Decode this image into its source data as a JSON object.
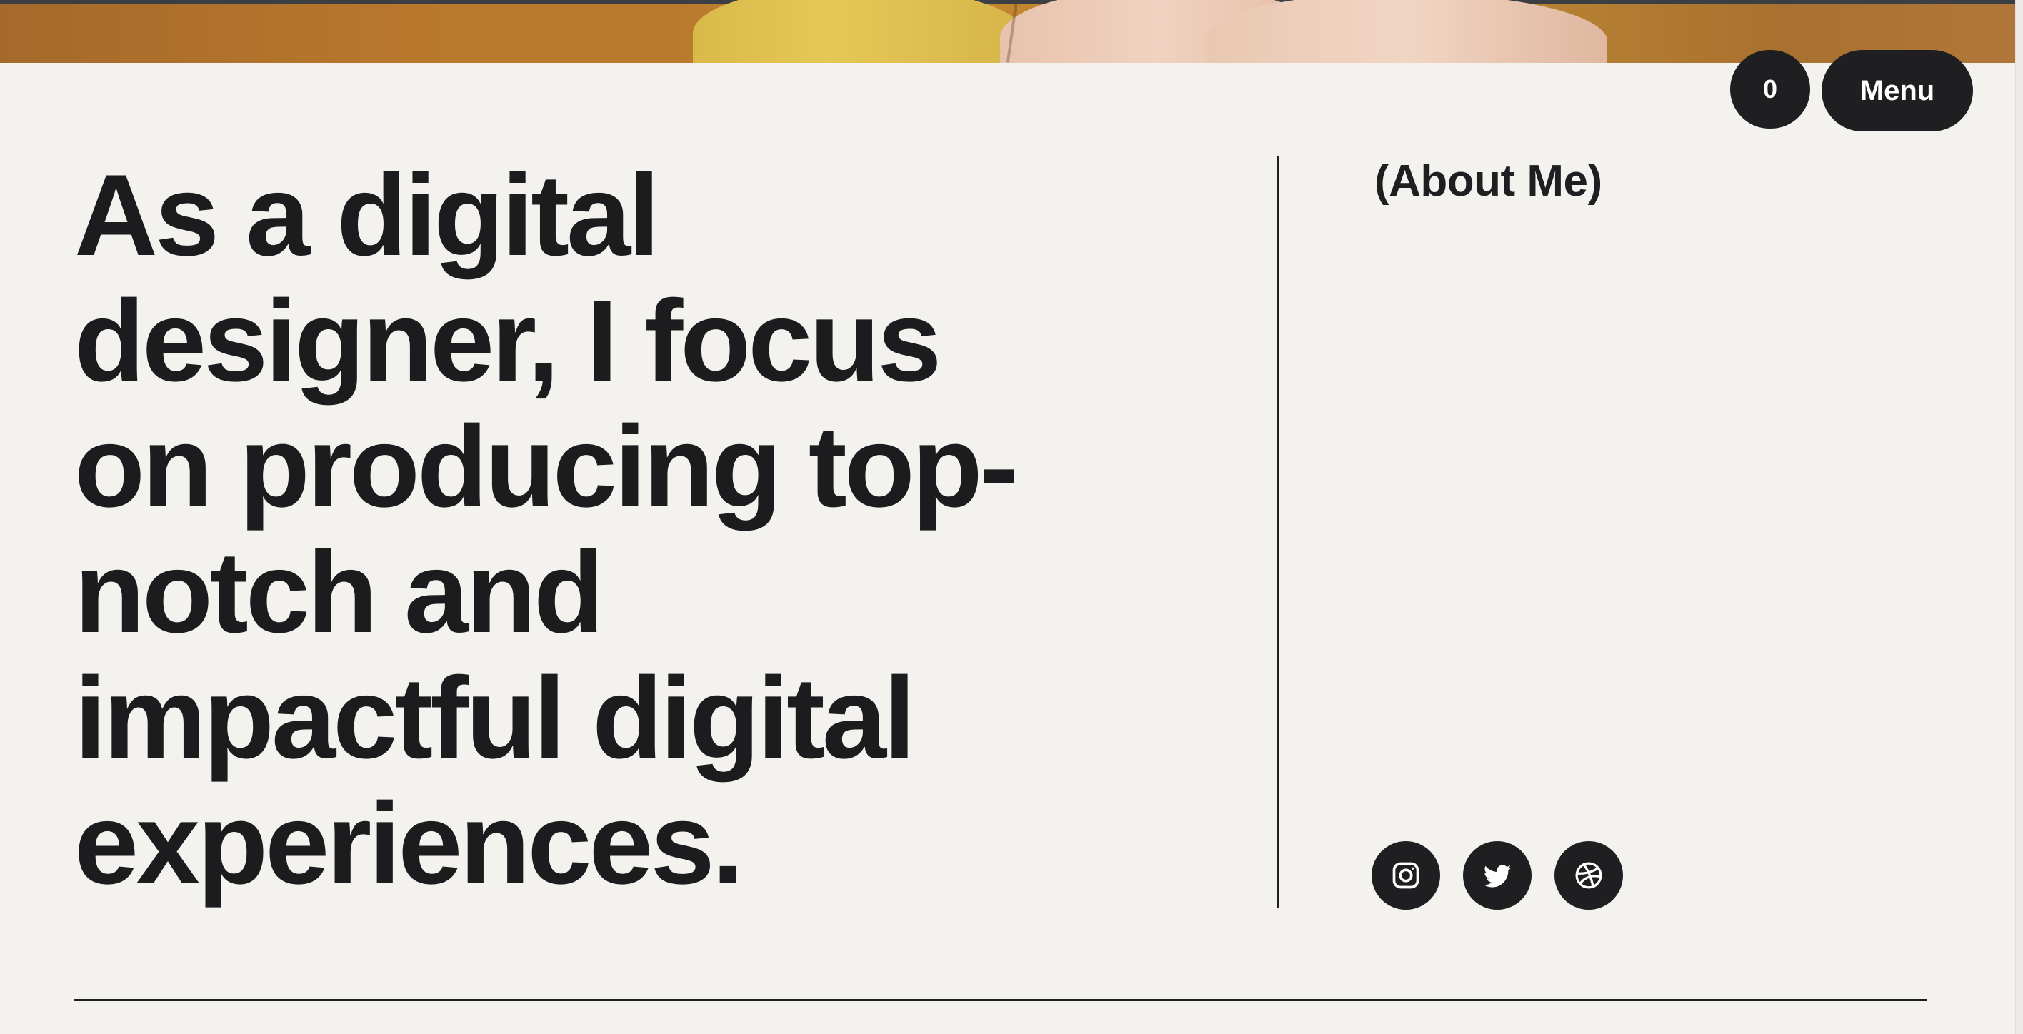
{
  "header": {
    "cart_count": "0",
    "menu_label": "Menu"
  },
  "hero": {
    "headline_lines": [
      "As a digital",
      "designer, I focus",
      "on producing top-",
      "notch and",
      "impactful digital",
      "experiences."
    ]
  },
  "about": {
    "label": "(About Me)"
  },
  "social": {
    "icons": [
      "instagram-icon",
      "twitter-icon",
      "dribbble-icon"
    ]
  },
  "colors": {
    "background": "#f3f2ee",
    "text": "#1c1c1e",
    "pill": "#1f1f21",
    "photo_strip": "#b97a2e"
  }
}
